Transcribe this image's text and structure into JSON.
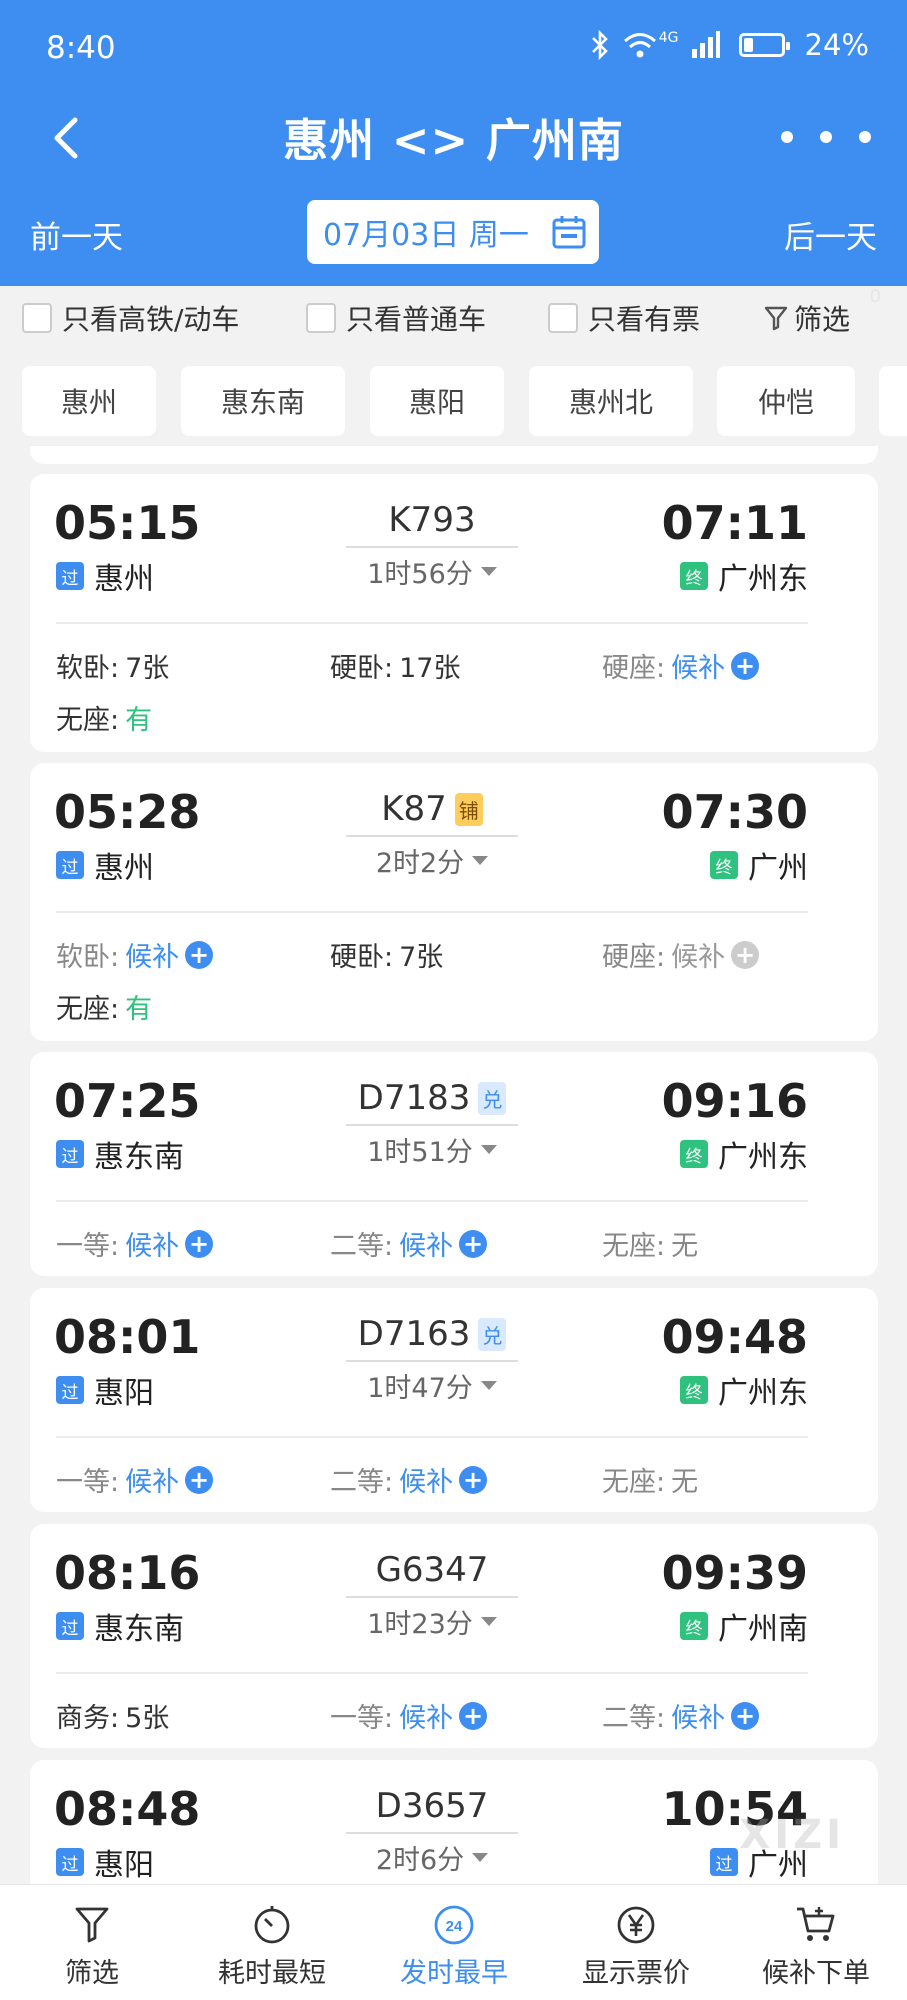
{
  "status_bar": {
    "time": "8:40",
    "network": "4G",
    "battery": "24%",
    "battery_level": 0.24
  },
  "header": {
    "title": "惠州 <> 广州南",
    "prev_day": "前一天",
    "next_day": "后一天",
    "date": "07月03日 周一"
  },
  "filters": {
    "high_speed": "只看高铁/动车",
    "normal": "只看普通车",
    "available": "只看有票",
    "filter": "筛选",
    "filter_count": "0"
  },
  "stations": [
    "惠州",
    "惠东南",
    "惠阳",
    "惠州北",
    "仲恺"
  ],
  "trains": [
    {
      "dep_time": "05:15",
      "dep_station": "惠州",
      "dep_tag": "过",
      "train_no": "K793",
      "badge": "",
      "duration": "1时56分",
      "arr_time": "07:11",
      "arr_station": "广州东",
      "arr_tag": "终",
      "seats": [
        {
          "label": "软卧:",
          "value": "7张",
          "type": "count"
        },
        {
          "label": "硬卧:",
          "value": "17张",
          "type": "count"
        },
        {
          "label": "硬座:",
          "value": "候补",
          "type": "wait"
        },
        {
          "label": "无座:",
          "value": "有",
          "type": "have"
        }
      ]
    },
    {
      "dep_time": "05:28",
      "dep_station": "惠州",
      "dep_tag": "过",
      "train_no": "K87",
      "badge": "铺",
      "duration": "2时2分",
      "arr_time": "07:30",
      "arr_station": "广州",
      "arr_tag": "终",
      "seats": [
        {
          "label": "软卧:",
          "value": "候补",
          "type": "wait"
        },
        {
          "label": "硬卧:",
          "value": "7张",
          "type": "count"
        },
        {
          "label": "硬座:",
          "value": "候补",
          "type": "wait-gray"
        },
        {
          "label": "无座:",
          "value": "有",
          "type": "have"
        }
      ]
    },
    {
      "dep_time": "07:25",
      "dep_station": "惠东南",
      "dep_tag": "过",
      "train_no": "D7183",
      "badge": "兑",
      "duration": "1时51分",
      "arr_time": "09:16",
      "arr_station": "广州东",
      "arr_tag": "终",
      "seats": [
        {
          "label": "一等:",
          "value": "候补",
          "type": "wait"
        },
        {
          "label": "二等:",
          "value": "候补",
          "type": "wait"
        },
        {
          "label": "无座:",
          "value": "无",
          "type": "none"
        }
      ]
    },
    {
      "dep_time": "08:01",
      "dep_station": "惠阳",
      "dep_tag": "过",
      "train_no": "D7163",
      "badge": "兑",
      "duration": "1时47分",
      "arr_time": "09:48",
      "arr_station": "广州东",
      "arr_tag": "终",
      "seats": [
        {
          "label": "一等:",
          "value": "候补",
          "type": "wait"
        },
        {
          "label": "二等:",
          "value": "候补",
          "type": "wait"
        },
        {
          "label": "无座:",
          "value": "无",
          "type": "none"
        }
      ]
    },
    {
      "dep_time": "08:16",
      "dep_station": "惠东南",
      "dep_tag": "过",
      "train_no": "G6347",
      "badge": "",
      "duration": "1时23分",
      "arr_time": "09:39",
      "arr_station": "广州南",
      "arr_tag": "终",
      "seats": [
        {
          "label": "商务:",
          "value": "5张",
          "type": "count"
        },
        {
          "label": "一等:",
          "value": "候补",
          "type": "wait"
        },
        {
          "label": "二等:",
          "value": "候补",
          "type": "wait"
        }
      ]
    },
    {
      "dep_time": "08:48",
      "dep_station": "惠阳",
      "dep_tag": "过",
      "train_no": "D3657",
      "badge": "",
      "duration": "2时6分",
      "arr_time": "10:54",
      "arr_station": "广州",
      "arr_tag": "过",
      "seats": []
    }
  ],
  "bottom_nav": [
    {
      "label": "筛选",
      "icon": "filter-icon"
    },
    {
      "label": "耗时最短",
      "icon": "timer-icon"
    },
    {
      "label": "发时最早",
      "icon": "clock-24-icon",
      "badge": "24",
      "active": true
    },
    {
      "label": "显示票价",
      "icon": "yen-icon"
    },
    {
      "label": "候补下单",
      "icon": "cart-icon"
    }
  ],
  "watermark": "XIZI",
  "colors": {
    "primary": "#3d8ef0",
    "green": "#2ec27e",
    "badge_yellow": "#ffcd5c"
  }
}
